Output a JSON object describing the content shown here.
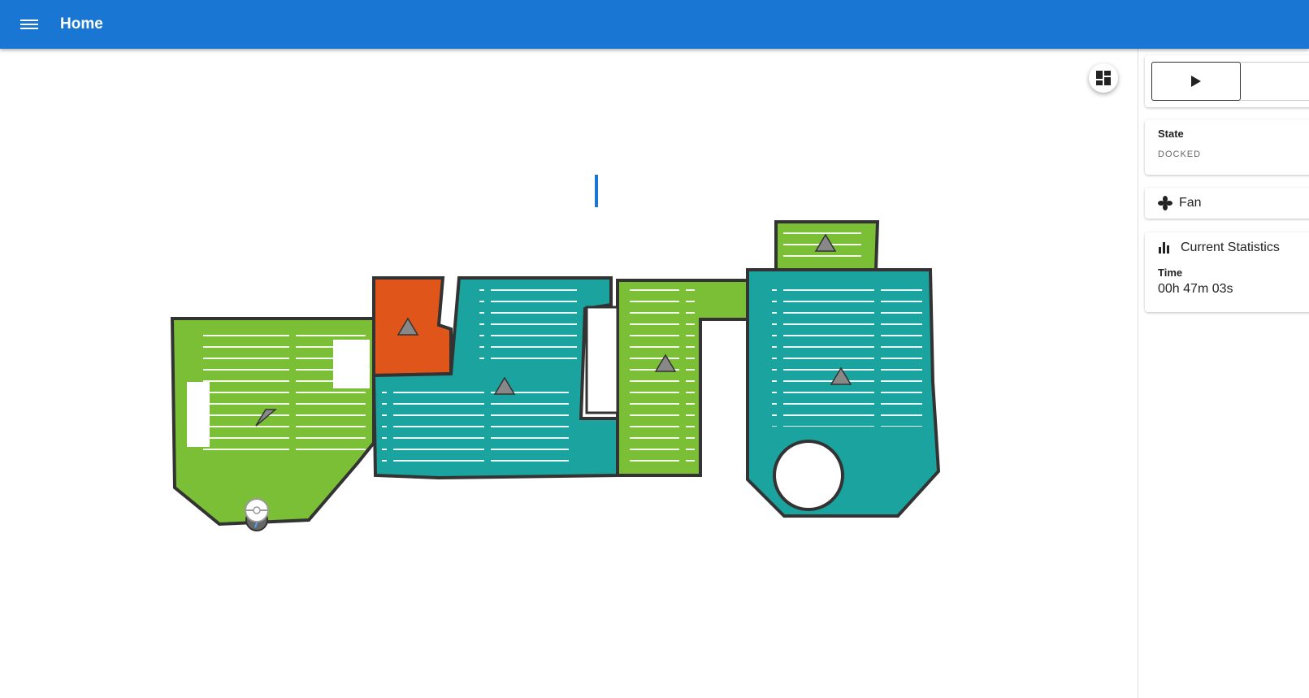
{
  "header": {
    "title": "Home",
    "menu_icon": "menu-icon"
  },
  "controls": {
    "play_icon": "play-icon",
    "layers_icon": "dashboard-icon"
  },
  "state": {
    "label": "State",
    "value": "DOCKED"
  },
  "fan": {
    "label": "Fan",
    "icon": "fan-icon"
  },
  "statistics": {
    "title": "Current Statistics",
    "icon": "bar-chart-icon",
    "time_label": "Time",
    "time_value": "00h 47m 03s"
  },
  "colors": {
    "header": "#1976d2",
    "room_green": "#7bbf37",
    "room_teal": "#1ba39f",
    "room_orange": "#e0561a",
    "wall": "#333333"
  }
}
